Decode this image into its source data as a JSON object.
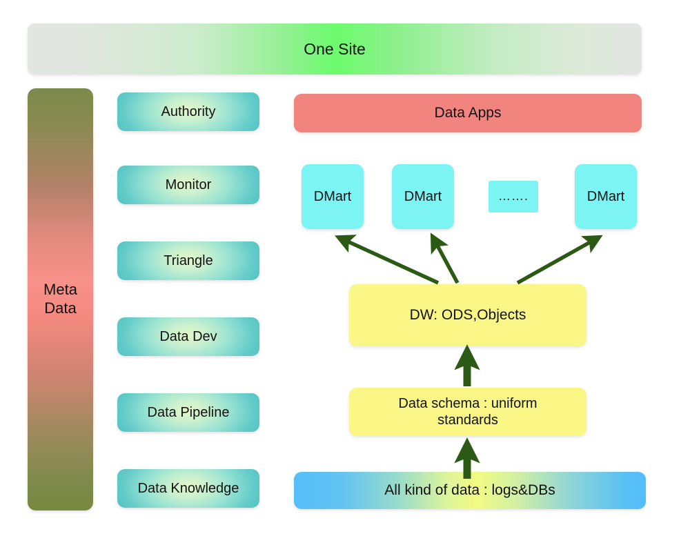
{
  "banner": {
    "label": "One Site"
  },
  "sidebar": {
    "meta_line1": "Meta",
    "meta_line2": "Data",
    "items": [
      {
        "label": "Authority"
      },
      {
        "label": "Monitor"
      },
      {
        "label": "Triangle"
      },
      {
        "label": "Data Dev"
      },
      {
        "label": "Data Pipeline"
      },
      {
        "label": "Data Knowledge"
      }
    ]
  },
  "main": {
    "apps_label": "Data Apps",
    "marts": [
      {
        "label": "DMart"
      },
      {
        "label": "DMart"
      },
      {
        "label": "DMart"
      }
    ],
    "ellipsis": "…….",
    "warehouse_label": "DW: ODS,Objects",
    "schema_label": "Data schema : uniform standards",
    "source_label": "All kind of data : logs&DBs"
  },
  "colors": {
    "arrow_green": "#2c5a14",
    "dmart_cyan": "#7df4f4",
    "apps_red": "#f1847f",
    "yellow": "#fbf786",
    "teal_edge": "#4bc0bd",
    "background": "#ffffff"
  }
}
